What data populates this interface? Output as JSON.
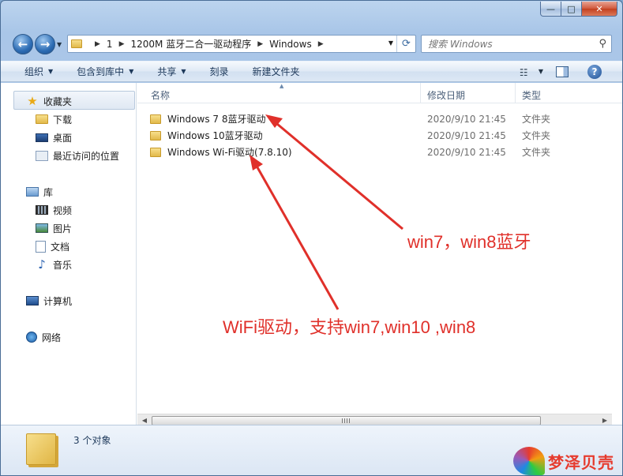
{
  "window": {
    "minimize_glyph": "—",
    "maximize_glyph": "□",
    "close_glyph": "✕"
  },
  "address": {
    "crumbs": [
      "1",
      "1200M 蓝牙二合一驱动程序",
      "Windows"
    ]
  },
  "search": {
    "placeholder": "搜索 Windows"
  },
  "toolbar": {
    "organize": "组织",
    "include_in_library": "包含到库中",
    "share": "共享",
    "burn": "刻录",
    "new_folder": "新建文件夹"
  },
  "sidebar": {
    "favorites": "收藏夹",
    "favorites_items": [
      "下载",
      "桌面",
      "最近访问的位置"
    ],
    "libraries": "库",
    "library_items": [
      "视频",
      "图片",
      "文档",
      "音乐"
    ],
    "computer": "计算机",
    "network": "网络"
  },
  "columns": {
    "name": "名称",
    "date_modified": "修改日期",
    "type": "类型"
  },
  "files": [
    {
      "name": "Windows 7 8蓝牙驱动",
      "date": "2020/9/10 21:45",
      "type": "文件夹"
    },
    {
      "name": "Windows 10蓝牙驱动",
      "date": "2020/9/10 21:45",
      "type": "文件夹"
    },
    {
      "name": "Windows Wi-Fi驱动(7.8.10)",
      "date": "2020/9/10 21:45",
      "type": "文件夹"
    }
  ],
  "annotations": {
    "bluetooth_note": "win7，win8蓝牙",
    "wifi_note": "WiFi驱动，支持win7,win10 ,win8"
  },
  "status": {
    "item_count": "3 个对象"
  },
  "watermark": {
    "text": "梦泽贝壳"
  },
  "colors": {
    "annotation_red": "#e0302a",
    "titlebar_blue": "#a9c6e8"
  }
}
